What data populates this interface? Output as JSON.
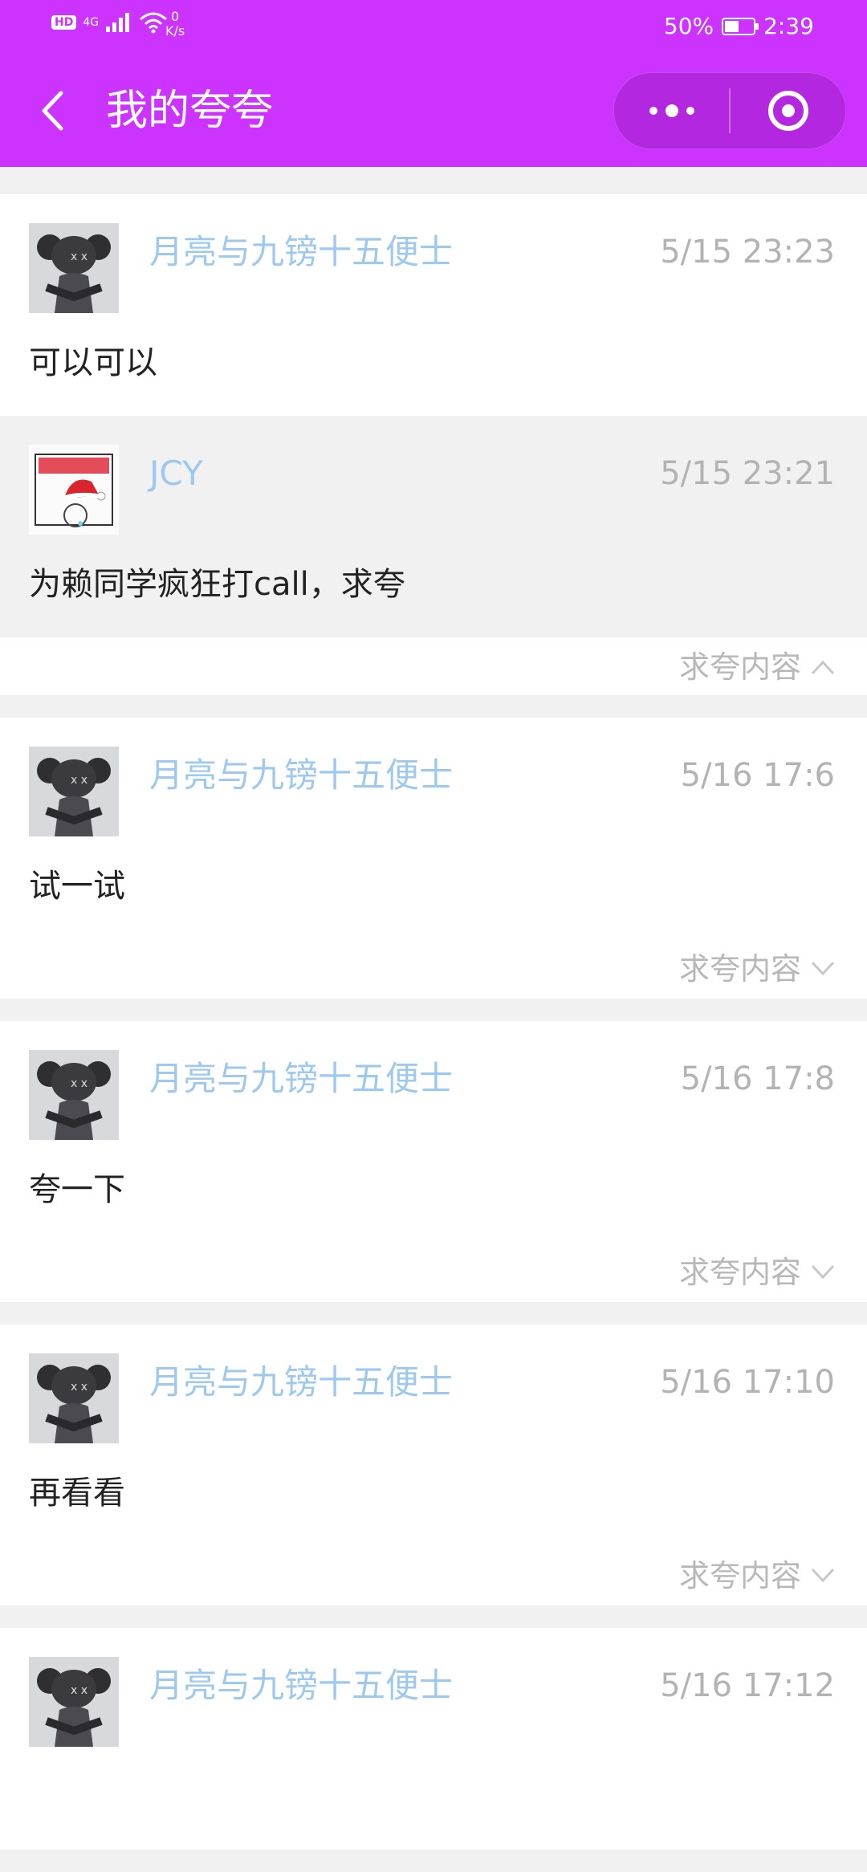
{
  "status_bar": {
    "hd": "HD",
    "network": "4G",
    "speed_value": "0",
    "speed_unit": "K/s",
    "battery_percent_text": "50%",
    "battery_level": 0.5,
    "time": "2:39"
  },
  "header": {
    "title": "我的夸夸",
    "back_icon": "chevron-left-icon",
    "menu_icon": "more-dots-icon",
    "close_icon": "target-circle-icon",
    "color": "#cc33ff"
  },
  "posts": [
    {
      "username": "月亮与九镑十五便士",
      "time": "5/15 23:23",
      "content": "可以可以",
      "reply": {
        "username": "JCY",
        "time": "5/15 23:21",
        "content": "为赖同学疯狂打call，求夸"
      },
      "toggle_label": "求夸内容",
      "expanded": true
    },
    {
      "username": "月亮与九镑十五便士",
      "time": "5/16 17:6",
      "content": "试一试",
      "toggle_label": "求夸内容",
      "expanded": false
    },
    {
      "username": "月亮与九镑十五便士",
      "time": "5/16 17:8",
      "content": "夸一下",
      "toggle_label": "求夸内容",
      "expanded": false
    },
    {
      "username": "月亮与九镑十五便士",
      "time": "5/16 17:10",
      "content": "再看看",
      "toggle_label": "求夸内容",
      "expanded": false
    },
    {
      "username": "月亮与九镑十五便士",
      "time": "5/16 17:12",
      "content": "",
      "toggle_label": "",
      "expanded": false
    }
  ],
  "colors": {
    "username": "#9dc9ee",
    "time": "#b3b3b3",
    "background": "#f1f1f1"
  }
}
